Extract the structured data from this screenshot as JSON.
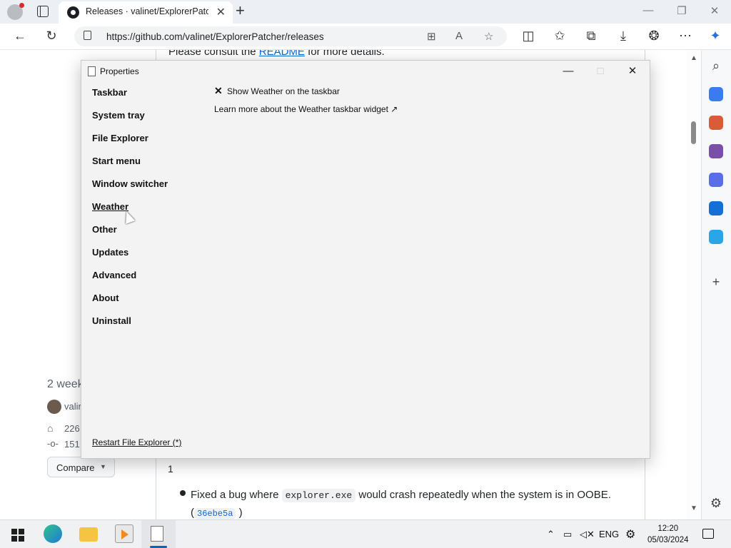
{
  "browser": {
    "tab_title": "Releases · valinet/ExplorerPatcher",
    "tab_close": "✕",
    "new_tab": "+",
    "url": "https://github.com/valinet/ExplorerPatcher/releases"
  },
  "window_controls": {
    "minimize": "—",
    "restore": "❐",
    "close": "✕"
  },
  "page": {
    "top_text_before": "Please consult the ",
    "top_link": "README",
    "top_text_after": " for more details.",
    "release_date": "2 week",
    "author": "valin",
    "tag": "226",
    "commit": "151",
    "compare_label": "Compare",
    "count": "1",
    "fix_prefix": "Fixed a bug where ",
    "fix_code": "explorer.exe",
    "fix_suffix": " would crash repeatedly when the system is in OOBE. (",
    "fix_commit": "36ebe5a",
    "fix_end": " )"
  },
  "dialog": {
    "title": "Properties",
    "nav": [
      "Taskbar",
      "System tray",
      "File Explorer",
      "Start menu",
      "Window switcher",
      "Weather",
      "Other",
      "Updates",
      "Advanced",
      "About",
      "Uninstall"
    ],
    "active_nav": "Weather",
    "option_label": "Show Weather on the taskbar",
    "option_checked": true,
    "learn_more": "Learn more about the Weather taskbar widget ↗",
    "restart": "Restart File Explorer (*)"
  },
  "taskbar": {
    "language": "ENG",
    "time": "12:20",
    "date": "05/03/2024"
  },
  "colors": {
    "link": "#0969da",
    "accent": "#0067c0",
    "dialog_bg": "#f3f3f3"
  }
}
